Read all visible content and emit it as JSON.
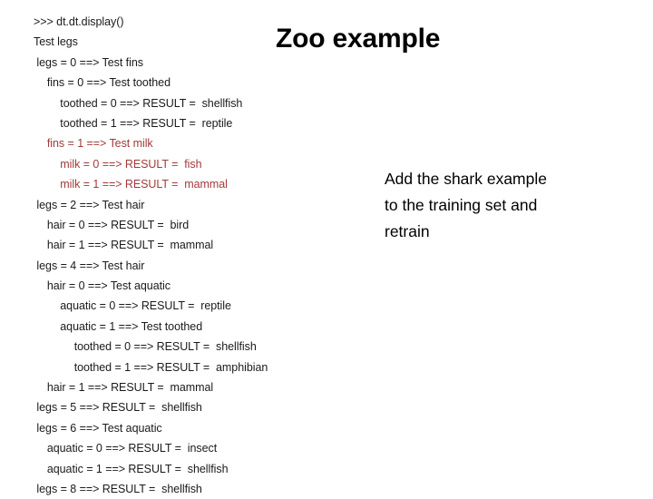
{
  "slide": {
    "title": "Zoo example",
    "background_color": "#ffffff",
    "text_color": "#000000",
    "highlight_color": "#a33a3a"
  },
  "console": {
    "prompt_line": ">>> dt.dt.display()",
    "lines": [
      {
        "depth": 0,
        "text": ">>> dt.dt.display()",
        "highlight": false
      },
      {
        "depth": 0,
        "text": "Test legs",
        "highlight": false
      },
      {
        "depth": 0,
        "text": " legs = 0 ==> Test fins",
        "highlight": false
      },
      {
        "depth": 1,
        "text": "  fins = 0 ==> Test toothed",
        "highlight": false
      },
      {
        "depth": 2,
        "text": "   toothed = 0 ==> RESULT =  shellfish",
        "highlight": false
      },
      {
        "depth": 2,
        "text": "   toothed = 1 ==> RESULT =  reptile",
        "highlight": false
      },
      {
        "depth": 1,
        "text": "  fins = 1 ==> Test milk",
        "highlight": true
      },
      {
        "depth": 2,
        "text": "   milk = 0 ==> RESULT =  fish",
        "highlight": true
      },
      {
        "depth": 2,
        "text": "   milk = 1 ==> RESULT =  mammal",
        "highlight": true
      },
      {
        "depth": 0,
        "text": " legs = 2 ==> Test hair",
        "highlight": false
      },
      {
        "depth": 1,
        "text": "  hair = 0 ==> RESULT =  bird",
        "highlight": false
      },
      {
        "depth": 1,
        "text": "  hair = 1 ==> RESULT =  mammal",
        "highlight": false
      },
      {
        "depth": 0,
        "text": " legs = 4 ==> Test hair",
        "highlight": false
      },
      {
        "depth": 1,
        "text": "  hair = 0 ==> Test aquatic",
        "highlight": false
      },
      {
        "depth": 2,
        "text": "   aquatic = 0 ==> RESULT =  reptile",
        "highlight": false
      },
      {
        "depth": 2,
        "text": "   aquatic = 1 ==> Test toothed",
        "highlight": false
      },
      {
        "depth": 3,
        "text": "    toothed = 0 ==> RESULT =  shellfish",
        "highlight": false
      },
      {
        "depth": 3,
        "text": "    toothed = 1 ==> RESULT =  amphibian",
        "highlight": false
      },
      {
        "depth": 1,
        "text": "  hair = 1 ==> RESULT =  mammal",
        "highlight": false
      },
      {
        "depth": 0,
        "text": " legs = 5 ==> RESULT =  shellfish",
        "highlight": false
      },
      {
        "depth": 0,
        "text": " legs = 6 ==> Test aquatic",
        "highlight": false
      },
      {
        "depth": 1,
        "text": "  aquatic = 0 ==> RESULT =  insect",
        "highlight": false
      },
      {
        "depth": 1,
        "text": "  aquatic = 1 ==> RESULT =  shellfish",
        "highlight": false
      },
      {
        "depth": 0,
        "text": " legs = 8 ==> RESULT =  shellfish",
        "highlight": false
      }
    ]
  },
  "note": {
    "lines": [
      "Add the shark example",
      "to the training set and",
      "retrain"
    ]
  }
}
